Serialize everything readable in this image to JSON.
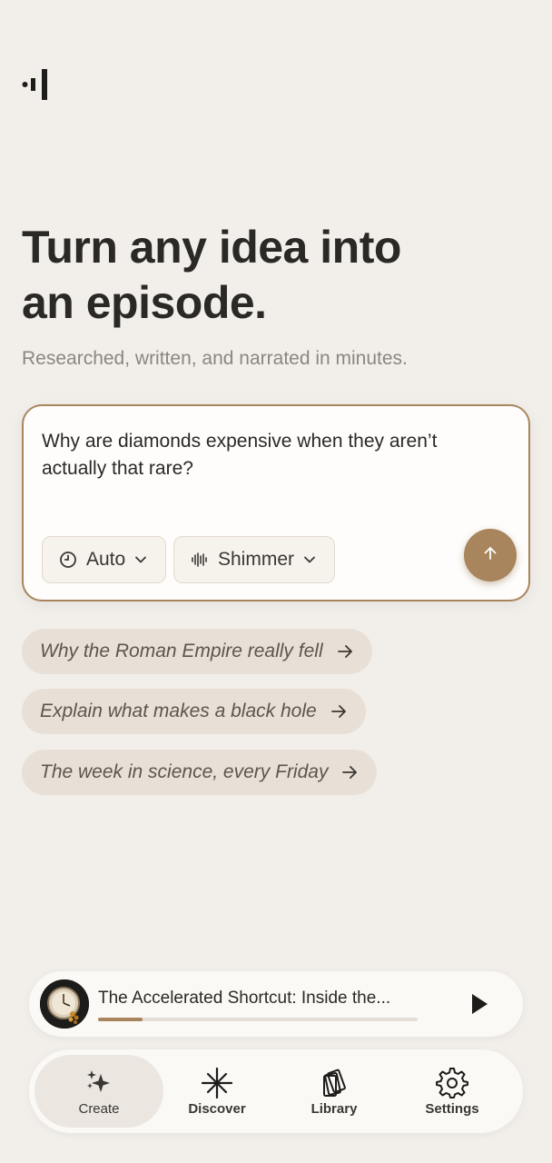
{
  "hero": {
    "title_line1": "Turn any idea into",
    "title_line2": "an episode.",
    "subtitle": "Researched, written, and narrated in minutes."
  },
  "prompt": {
    "text": "Why are diamonds expensive when they aren’t actually that rare?",
    "length_option": "Auto",
    "voice_option": "Shimmer"
  },
  "suggestions": [
    {
      "label": "Why the Roman Empire really fell"
    },
    {
      "label": "Explain what makes a black hole"
    },
    {
      "label": "The week in science, every Friday"
    }
  ],
  "player": {
    "title": "The Accelerated Shortcut: Inside the...",
    "progress": 0.14
  },
  "tabs": [
    {
      "label": "Create",
      "icon": "sparkles-icon",
      "active": true
    },
    {
      "label": "Discover",
      "icon": "starburst-icon",
      "active": false
    },
    {
      "label": "Library",
      "icon": "stack-icon",
      "active": false
    },
    {
      "label": "Settings",
      "icon": "gear-icon",
      "active": false
    }
  ],
  "colors": {
    "background": "#f2efeb",
    "accent": "#a8855c",
    "suggestion_bg": "#e8e0d6"
  }
}
